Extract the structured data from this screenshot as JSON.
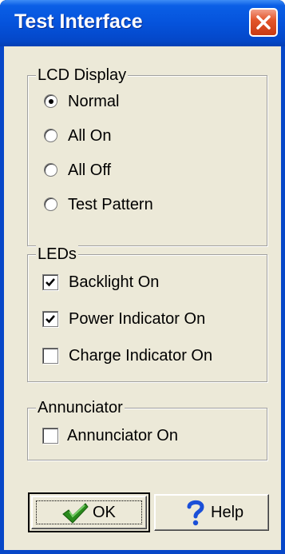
{
  "window": {
    "title": "Test Interface"
  },
  "lcd_display": {
    "label": "LCD Display",
    "options": [
      {
        "label": "Normal",
        "selected": true
      },
      {
        "label": "All On",
        "selected": false
      },
      {
        "label": "All Off",
        "selected": false
      },
      {
        "label": "Test Pattern",
        "selected": false
      }
    ]
  },
  "leds": {
    "label": "LEDs",
    "options": [
      {
        "label": "Backlight On",
        "checked": true
      },
      {
        "label": "Power Indicator On",
        "checked": true
      },
      {
        "label": "Charge Indicator On",
        "checked": false
      }
    ]
  },
  "annunciator": {
    "label": "Annunciator",
    "options": [
      {
        "label": "Annunciator On",
        "checked": false
      }
    ]
  },
  "buttons": {
    "ok": {
      "label": "OK",
      "icon": "checkmark-icon"
    },
    "help": {
      "label": "Help",
      "icon": "question-mark-icon"
    }
  },
  "colors": {
    "titlebar": "#0553dc",
    "client_bg": "#ece9d8",
    "close_button": "#e3562b",
    "ok_check": "#2a8a1c",
    "help_question": "#1a4fd8"
  }
}
